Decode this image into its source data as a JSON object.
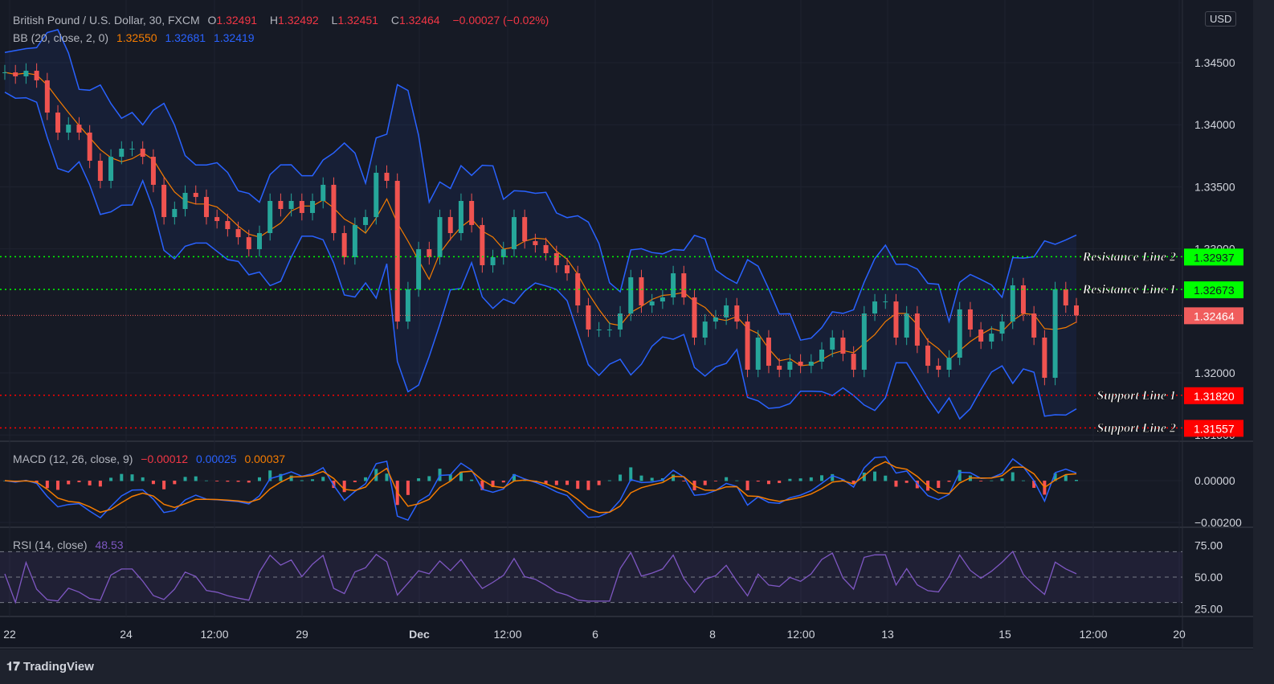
{
  "header": {
    "symbol": "British Pound / U.S. Dollar, 30, FXCM",
    "open_label": "O",
    "open": "1.32491",
    "high_label": "H",
    "high": "1.32492",
    "low_label": "L",
    "low": "1.32451",
    "close_label": "C",
    "close": "1.32464",
    "change": "−0.00027 (−0.02%)"
  },
  "bb": {
    "label": "BB (20, close, 2, 0)",
    "basis": "1.32550",
    "upper": "1.32681",
    "lower": "1.32419"
  },
  "macd": {
    "label": "MACD (12, 26, close, 9)",
    "hist": "−0.00012",
    "macd": "0.00025",
    "signal": "0.00037"
  },
  "rsi": {
    "label": "RSI (14, close)",
    "value": "48.53"
  },
  "currency": "USD",
  "brand": "TradingView",
  "colors": {
    "background": "#131722",
    "up": "#26a69a",
    "down": "#ef5350",
    "bb_basis": "#f57c00",
    "bb_band": "#2962ff",
    "rsi": "#7e57c2",
    "resistance": "#00ff00",
    "support": "#ff0000",
    "last_price": "#f05d5d"
  },
  "chart_data": [
    {
      "type": "candlestick",
      "title": "British Pound / U.S. Dollar, 30, FXCM",
      "ylim": [
        1.3145,
        1.3475
      ],
      "price_ticks": [
        "1.34500",
        "1.34000",
        "1.33500",
        "1.33000",
        "1.32000",
        "1.31500"
      ],
      "x_ticks": [
        "22",
        "24",
        "12:00",
        "29",
        "Dec",
        "12:00",
        "6",
        "8",
        "12:00",
        "13",
        "15",
        "12:00",
        "20"
      ],
      "close": [
        1.34422,
        1.3439,
        1.34435,
        1.34358,
        1.34098,
        1.33937,
        1.34001,
        1.33937,
        1.3371,
        1.33548,
        1.33742,
        1.33807,
        1.33807,
        1.33742,
        1.33516,
        1.33256,
        1.33321,
        1.33451,
        1.33418,
        1.33256,
        1.33224,
        1.33159,
        1.33094,
        1.32997,
        1.33127,
        1.33386,
        1.33321,
        1.33386,
        1.33289,
        1.33386,
        1.33516,
        1.33127,
        1.32933,
        1.33192,
        1.33256,
        1.33613,
        1.33548,
        1.32414,
        1.32674,
        1.32997,
        1.32933,
        1.33256,
        1.33127,
        1.33386,
        1.33192,
        1.32868,
        1.32933,
        1.32997,
        1.33256,
        1.33062,
        1.3303,
        1.32965,
        1.32868,
        1.32803,
        1.32544,
        1.3235,
        1.3235,
        1.3235,
        1.32479,
        1.32771,
        1.32544,
        1.32576,
        1.32609,
        1.32803,
        1.32609,
        1.32285,
        1.32414,
        1.32447,
        1.32544,
        1.32414,
        1.32026,
        1.32285,
        1.32058,
        1.32026,
        1.32091,
        1.32058,
        1.32091,
        1.32188,
        1.32285,
        1.32155,
        1.32026,
        1.32479,
        1.32576,
        1.32576,
        1.32285,
        1.32479,
        1.3222,
        1.32058,
        1.32026,
        1.32123,
        1.32512,
        1.3235,
        1.32253,
        1.32317,
        1.32414,
        1.32706,
        1.32479,
        1.32285,
        1.31961,
        1.32674,
        1.32544,
        1.32464
      ],
      "levels": [
        {
          "name": "Resistance Line 2",
          "price": "1.32937",
          "kind": "resistance"
        },
        {
          "name": "Resistance Line 1",
          "price": "1.32673",
          "kind": "resistance"
        },
        {
          "name": "Support Line 1",
          "price": "1.31820",
          "kind": "support"
        },
        {
          "name": "Support Line 2",
          "price": "1.31557",
          "kind": "support"
        }
      ],
      "last_price": "1.32464"
    },
    {
      "type": "line",
      "title": "MACD (12, 26, close, 9)",
      "ticks": [
        "0.00000",
        "−0.00200"
      ],
      "ylim": [
        -0.0021,
        0.0012
      ]
    },
    {
      "type": "line",
      "title": "RSI (14, close)",
      "ticks": [
        "75.00",
        "50.00",
        "25.00"
      ],
      "ylim": [
        20,
        80
      ],
      "bands": [
        30,
        50,
        70
      ]
    }
  ]
}
